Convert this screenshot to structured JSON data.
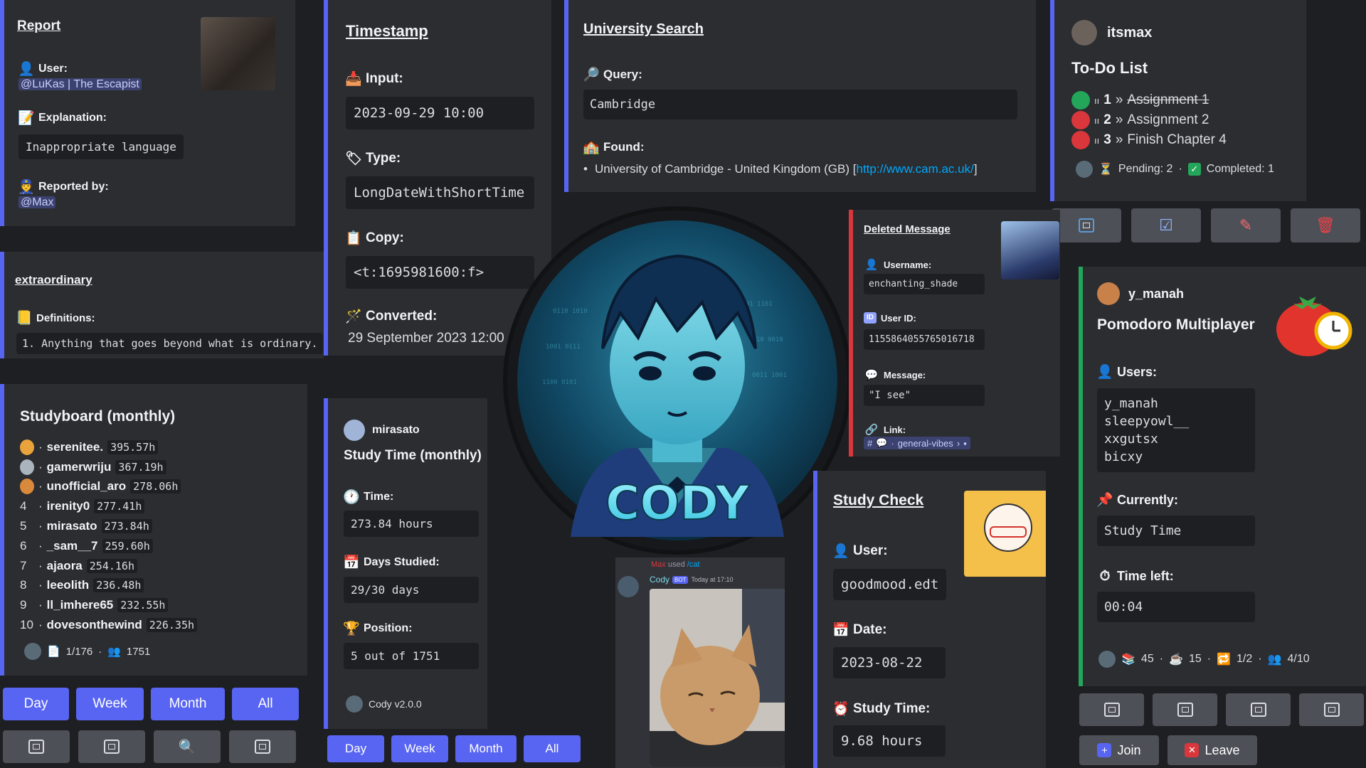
{
  "report": {
    "title": "Report",
    "user_label": "User:",
    "user_value": "@LuKas | The Escapist",
    "explanation_label": "Explanation:",
    "explanation_value": "Inappropriate language",
    "reported_by_label": "Reported by:",
    "reported_by_value": "@Max"
  },
  "definition": {
    "title": "extraordinary",
    "definitions_label": "Definitions:",
    "definition_1": "1. Anything that goes beyond what is ordinary."
  },
  "studyboard": {
    "title": "Studyboard (monthly)",
    "entries": [
      {
        "rank": "",
        "name": "serenitee.",
        "hours": "395.57h"
      },
      {
        "rank": "",
        "name": "gamerwriju",
        "hours": "367.19h"
      },
      {
        "rank": "",
        "name": "unofficial_aro",
        "hours": "278.06h"
      },
      {
        "rank": "4",
        "name": "irenity0",
        "hours": "277.41h"
      },
      {
        "rank": "5",
        "name": "mirasato",
        "hours": "273.84h"
      },
      {
        "rank": "6",
        "name": "_sam__7",
        "hours": "259.60h"
      },
      {
        "rank": "7",
        "name": "ajaora",
        "hours": "254.16h"
      },
      {
        "rank": "8",
        "name": "leeolith",
        "hours": "236.48h"
      },
      {
        "rank": "9",
        "name": "ll_imhere65",
        "hours": "232.55h"
      },
      {
        "rank": "10",
        "name": "dovesonthewind",
        "hours": "226.35h"
      }
    ],
    "footer_pages": "1/176",
    "footer_users": "1751",
    "buttons": [
      "Day",
      "Week",
      "Month",
      "All"
    ]
  },
  "timestamp": {
    "title": "Timestamp",
    "input_label": "Input:",
    "input_value": "2023-09-29 10:00",
    "type_label": "Type:",
    "type_value": "LongDateWithShortTime",
    "copy_label": "Copy:",
    "copy_value": "<t:1695981600:f>",
    "converted_label": "Converted:",
    "converted_value": "29 September 2023 12:00"
  },
  "study_time": {
    "username": "mirasato",
    "title": "Study Time (monthly)",
    "time_label": "Time:",
    "time_value": "273.84 hours",
    "days_label": "Days Studied:",
    "days_value": "29/30 days",
    "position_label": "Position:",
    "position_value": "5 out of 1751",
    "footer": "Cody v2.0.0",
    "buttons": [
      "Day",
      "Week",
      "Month",
      "All"
    ]
  },
  "university": {
    "title": "University Search",
    "query_label": "Query:",
    "query_value": "Cambridge",
    "found_label": "Found:",
    "found_text": "University of Cambridge - United Kingdom (GB) [",
    "found_link": "http://www.cam.ac.uk/",
    "found_close": "]"
  },
  "logo": {
    "text": "CODY"
  },
  "todo": {
    "username": "itsmax",
    "title": "To-Do List",
    "items": [
      {
        "num": "1",
        "text": "Assignment 1",
        "color": "#23a55a",
        "done": true
      },
      {
        "num": "2",
        "text": "Assignment 2",
        "color": "#da373c",
        "done": false
      },
      {
        "num": "3",
        "text": "Finish Chapter 4",
        "color": "#da373c",
        "done": false
      }
    ],
    "pending": "Pending: 2",
    "completed": "Completed: 1"
  },
  "deleted": {
    "title": "Deleted Message",
    "username_label": "Username:",
    "username_value": "enchanting_shade",
    "userid_label": "User ID:",
    "userid_value": "1155864055765016718",
    "message_label": "Message:",
    "message_value": "\"I see\"",
    "link_label": "Link:",
    "link_value": "general-vibes"
  },
  "cat": {
    "invoker": "Max",
    "used": "used",
    "command": "/cat",
    "bot_name": "Cody",
    "bot_badge": "BOT",
    "time": "Today at 17:10"
  },
  "study_check": {
    "title": "Study Check",
    "user_label": "User:",
    "user_value": "goodmood.edt",
    "date_label": "Date:",
    "date_value": "2023-08-22",
    "study_time_label": "Study Time:",
    "study_time_value": "9.68 hours"
  },
  "pomodoro": {
    "username": "y_manah",
    "title": "Pomodoro Multiplayer",
    "users_label": "Users:",
    "users": [
      "y_manah",
      "sleepyowl__",
      "xxgutsx",
      "bicxy"
    ],
    "currently_label": "Currently:",
    "currently_value": "Study Time",
    "time_left_label": "Time left:",
    "time_left_value": "00:04",
    "stat_1": "45",
    "stat_2": "15",
    "stat_3": "1/2",
    "stat_4": "4/10",
    "join_label": "Join",
    "leave_label": "Leave"
  },
  "colors": {
    "background": "#1e1f22",
    "card": "#2b2d31",
    "blurple": "#5865f2",
    "red": "#da373c",
    "green": "#23a55a",
    "link": "#00a8fc"
  }
}
